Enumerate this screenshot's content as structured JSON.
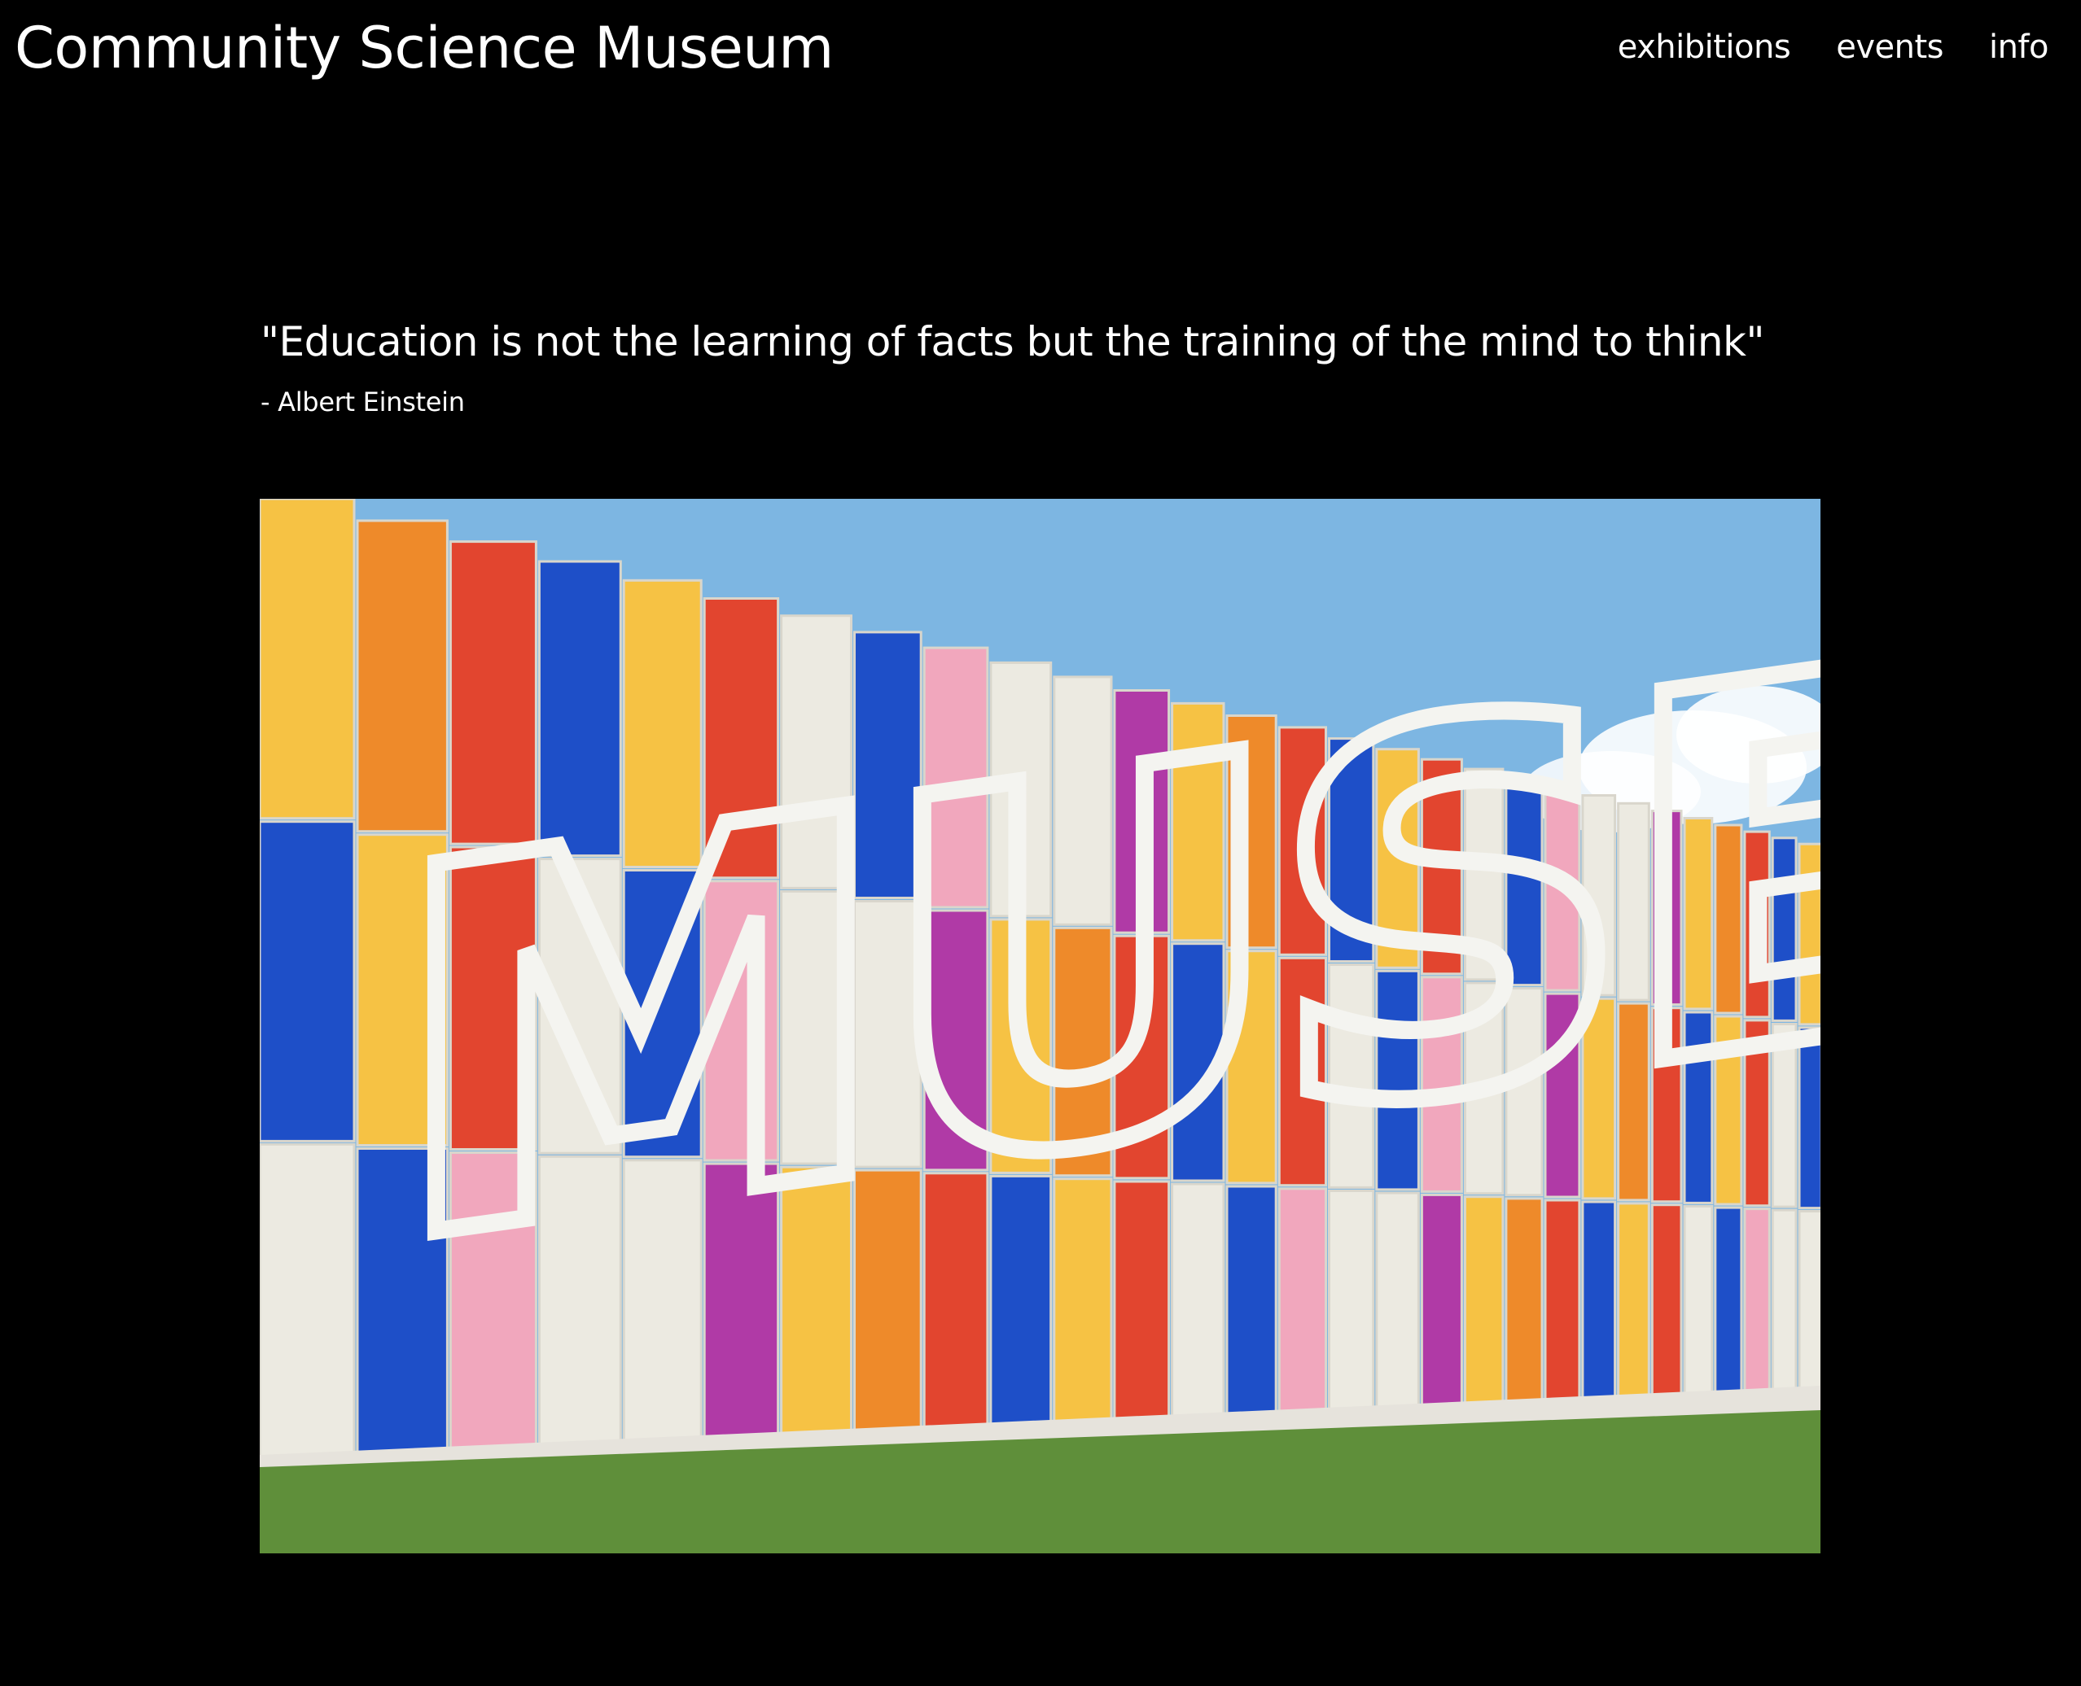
{
  "header": {
    "site_title": "Community Science Museum",
    "nav": [
      {
        "label": "exhibitions"
      },
      {
        "label": "events"
      },
      {
        "label": "info"
      }
    ]
  },
  "quote": {
    "text": "\"Education is not the learning of facts but the training of the mind to think\"",
    "attribution": "- Albert Einstein"
  },
  "hero_image": {
    "sign_text": "MUSEUM",
    "colors": {
      "sky": "#7db6e2",
      "grass": "#5f8f3a",
      "yellow": "#f6c244",
      "red": "#e2452f",
      "blue": "#1e4fc8",
      "orange": "#ee8a2a",
      "pink": "#f1a7bd",
      "white": "#eceae1",
      "magenta": "#b03aa6"
    }
  }
}
